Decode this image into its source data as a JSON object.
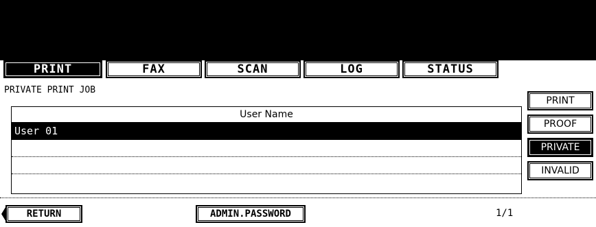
{
  "tabs": [
    {
      "label": "PRINT",
      "active": true
    },
    {
      "label": "FAX",
      "active": false
    },
    {
      "label": "SCAN",
      "active": false
    },
    {
      "label": "LOG",
      "active": false
    },
    {
      "label": "STATUS",
      "active": false
    }
  ],
  "section_title": "PRIVATE PRINT JOB",
  "list": {
    "header": "User Name",
    "rows": [
      "User 01",
      "",
      "",
      ""
    ],
    "selected_index": 0
  },
  "side_buttons": [
    {
      "label": "PRINT",
      "active": false
    },
    {
      "label": "PROOF",
      "active": false
    },
    {
      "label": "PRIVATE",
      "active": true
    },
    {
      "label": "INVALID",
      "active": false
    }
  ],
  "bottom": {
    "return_label": "RETURN",
    "admin_label": "ADMIN.PASSWORD",
    "page_indicator": "1/1"
  }
}
